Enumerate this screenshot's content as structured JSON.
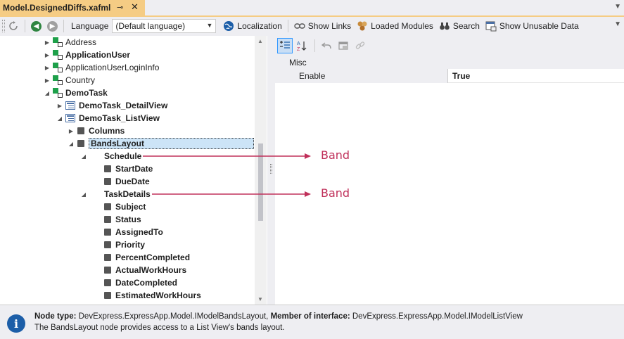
{
  "tab": {
    "title": "Model.DesignedDiffs.xafml",
    "pin": "⊸",
    "close": "✕"
  },
  "toolbar": {
    "language_label": "Language",
    "language_value": "(Default language)",
    "localization": "Localization",
    "show_links": "Show Links",
    "loaded_modules": "Loaded Modules",
    "search": "Search",
    "show_unusable": "Show Unusable Data"
  },
  "tree": {
    "address": "Address",
    "application_user": "ApplicationUser",
    "application_user_login_info": "ApplicationUserLoginInfo",
    "country": "Country",
    "demo_task": "DemoTask",
    "demo_task_detail_view": "DemoTask_DetailView",
    "demo_task_list_view": "DemoTask_ListView",
    "columns": "Columns",
    "bands_layout": "BandsLayout",
    "schedule": "Schedule",
    "start_date": "StartDate",
    "due_date": "DueDate",
    "task_details": "TaskDetails",
    "subject": "Subject",
    "status": "Status",
    "assigned_to": "AssignedTo",
    "priority": "Priority",
    "percent_completed": "PercentCompleted",
    "actual_work_hours": "ActualWorkHours",
    "date_completed": "DateCompleted",
    "estimated_work_hours": "EstimatedWorkHours"
  },
  "properties": {
    "category": "Misc",
    "enable_name": "Enable",
    "enable_value": "True"
  },
  "annotations": {
    "band1": "Band",
    "band2": "Band"
  },
  "status": {
    "node_type_label": "Node type:",
    "node_type_value": " DevExpress.ExpressApp.Model.IModelBandsLayout, ",
    "member_label": "Member of interface:",
    "member_value": " DevExpress.ExpressApp.Model.IModelListView",
    "description": "The BandsLayout node provides access to a List View's bands layout."
  },
  "colors": {
    "tab_accent": "#f5cc84",
    "annotation": "#c0305a",
    "info": "#1c5ea8",
    "selection": "#cce4f7"
  }
}
